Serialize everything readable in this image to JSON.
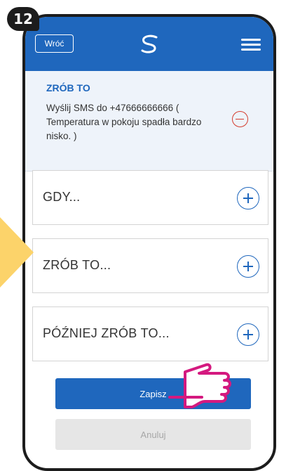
{
  "step": {
    "number": "12"
  },
  "header": {
    "back_label": "Wróć",
    "logo_icon": "brand-s-logo-icon",
    "menu_icon": "hamburger-menu-icon"
  },
  "action_card": {
    "title": "ZRÓB TO",
    "text": "Wyślij SMS do +47666666666 ( Temperatura w pokoju spadła bardzo nisko. )",
    "remove_icon": "minus-circle-icon"
  },
  "rows": [
    {
      "label": "GDY...",
      "icon": "plus-circle-icon"
    },
    {
      "label": "ZRÓB TO...",
      "icon": "plus-circle-icon"
    },
    {
      "label": "PÓŹNIEJ ZRÓB TO...",
      "icon": "plus-circle-icon"
    }
  ],
  "buttons": {
    "save_label": "Zapisz",
    "cancel_label": "Anuluj"
  },
  "colors": {
    "brand_blue": "#1f67bd",
    "remove_red": "#d43d2f",
    "highlight_arrow": "#fcd36a",
    "pointer_pink": "#d4197f"
  }
}
